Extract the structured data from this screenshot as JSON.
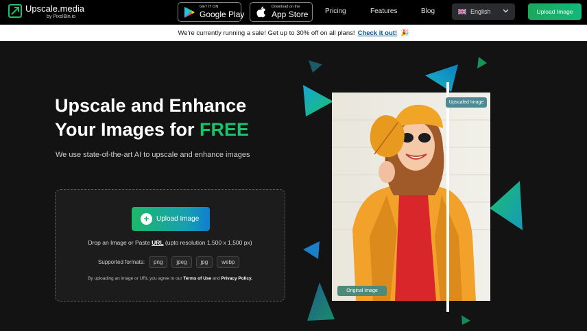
{
  "nav": {
    "logo_name": "Upscale.media",
    "logo_sub": "by PixelBin.io",
    "google_play": {
      "small": "GET IT ON",
      "big": "Google Play"
    },
    "app_store": {
      "small": "Download on the",
      "big": "App Store"
    },
    "links": [
      "Pricing",
      "Features",
      "Blog"
    ],
    "language": "English",
    "upload_button": "Upload Image"
  },
  "banner": {
    "text": "We're currently running a sale! Get up to 30% off on all plans!",
    "link": "Check it out!",
    "emoji": "🎉"
  },
  "hero": {
    "title_line1": "Upscale and Enhance",
    "title_line2": "Your Images for ",
    "title_free": "FREE",
    "subtitle": "We use state-of-the-art AI to upscale and enhance images"
  },
  "dropzone": {
    "button": "Upload Image",
    "drop_prefix": "Drop an Image or Paste ",
    "drop_url": "URL",
    "drop_suffix": " (upto resolution 1,500 x 1,500 px)",
    "formats_label": "Supported formats:",
    "formats": [
      "png",
      "jpeg",
      "jpg",
      "webp"
    ],
    "terms_prefix": "By uploading an image or URL you agree to our ",
    "terms_link": "Terms of Use",
    "terms_mid": " and ",
    "privacy_link": "Privacy Policy."
  },
  "preview": {
    "upscaled_label": "Upscaled Image",
    "original_label": "Original Image"
  },
  "colors": {
    "accent_green": "#1bc26e",
    "banner_link": "#0d4f8b",
    "background": "#131313"
  }
}
